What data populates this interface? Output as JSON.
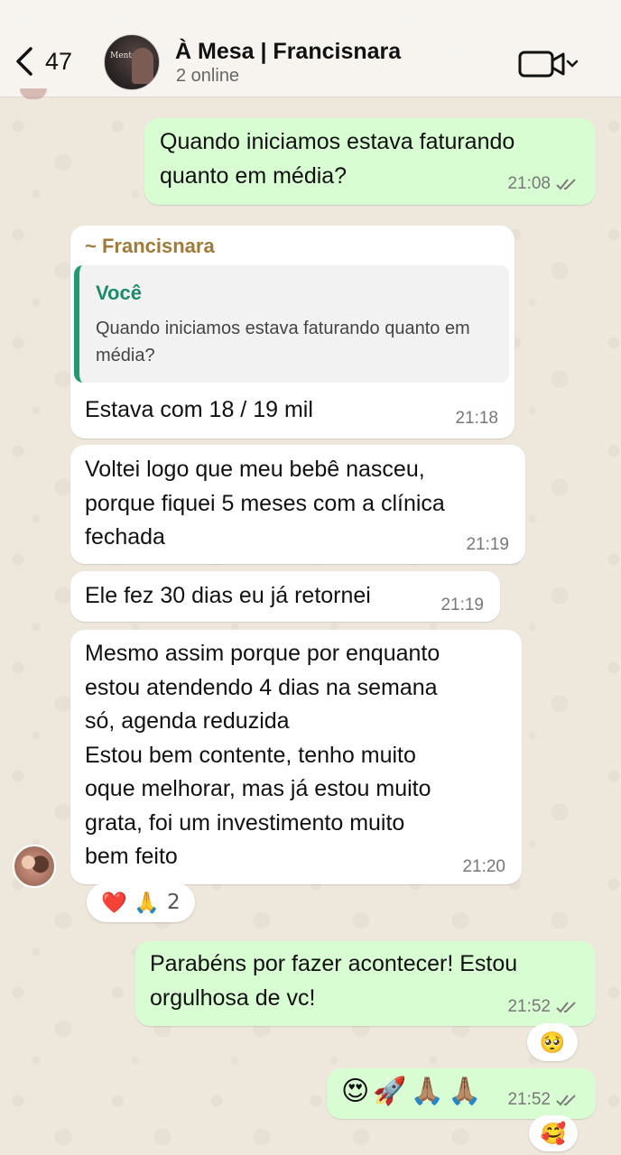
{
  "header": {
    "back_count": "47",
    "group_name": "À Mesa | Francisnara",
    "group_status": "2 online",
    "avatar_text": "Mentoria"
  },
  "messages": [
    {
      "direction": "outgoing",
      "text": "Quando iniciamos estava faturando\nquanto em média?",
      "time": "21:08",
      "read": true
    },
    {
      "direction": "incoming",
      "sender": "~ Francisnara",
      "quote": {
        "author": "Você",
        "text": "Quando iniciamos estava faturando quanto em média?"
      },
      "text": "Estava com 18 / 19 mil",
      "time": "21:18"
    },
    {
      "direction": "incoming",
      "text": "Voltei logo que meu bebê nasceu,\nporque fiquei 5 meses com a clínica\nfechada",
      "time": "21:19"
    },
    {
      "direction": "incoming",
      "text": "Ele fez 30 dias eu já retornei",
      "time": "21:19"
    },
    {
      "direction": "incoming",
      "text": "Mesmo assim porque por enquanto\nestou atendendo 4 dias na semana\nsó, agenda reduzida\nEstou bem contente, tenho muito\noque melhorar, mas já estou muito\ngrata, foi um investimento muito\nbem feito",
      "time": "21:20",
      "reactions": {
        "emojis": "❤️ 🙏",
        "count": "2"
      }
    },
    {
      "direction": "outgoing",
      "text": "Parabéns por fazer acontecer! Estou\norgulhosa de vc!",
      "time": "21:52",
      "read": true,
      "reaction": "🥺"
    },
    {
      "direction": "outgoing",
      "text": "😍🚀🙏🏽🙏🏽",
      "time": "21:52",
      "read": true,
      "reaction": "🥰"
    }
  ],
  "colors": {
    "outgoing_bubble": "#d9fdd3",
    "incoming_bubble": "#ffffff",
    "sender_name": "#a07a3a",
    "quote_author": "#1f8a6a",
    "read_ticks": "#7a7a7a"
  },
  "icons": [
    "back-chevron-icon",
    "video-call-icon",
    "chevron-down-icon",
    "double-check-icon"
  ]
}
